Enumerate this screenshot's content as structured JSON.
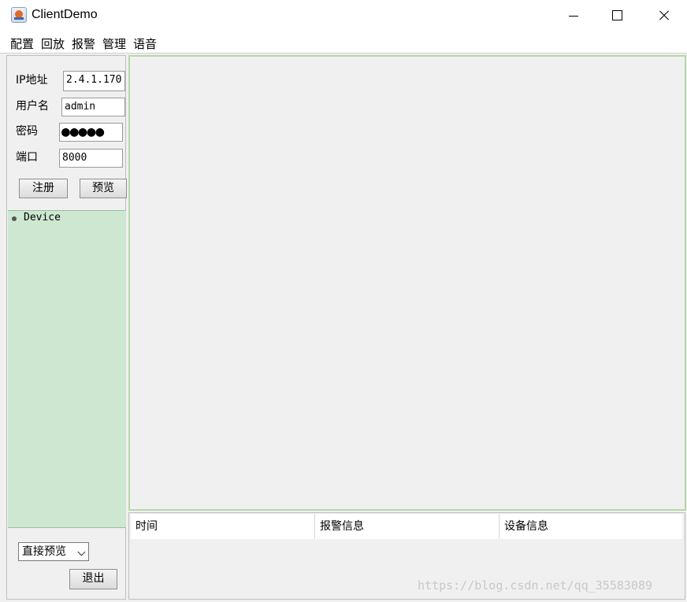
{
  "window": {
    "title": "ClientDemo",
    "icon": "java-cup-icon"
  },
  "menu": [
    "配置",
    "回放",
    "报警",
    "管理",
    "语音"
  ],
  "login": {
    "ip_label": "IP地址",
    "ip_value": "2.4.1.170",
    "user_label": "用户名",
    "user_value": "admin",
    "pwd_label": "密码",
    "pwd_value": "●●●●●",
    "port_label": "端口",
    "port_value": "8000",
    "register_label": "注册",
    "preview_label": "预览"
  },
  "tree": {
    "root": "Device"
  },
  "bottom": {
    "mode_select": "直接预览",
    "exit_label": "退出"
  },
  "alarm_table": {
    "columns": [
      "时间",
      "报警信息",
      "设备信息"
    ]
  },
  "watermark": "https://blog.csdn.net/qq_35583089",
  "colors": {
    "tree_bg": "#cde7d0",
    "preview_border": "#b6d7a8"
  }
}
